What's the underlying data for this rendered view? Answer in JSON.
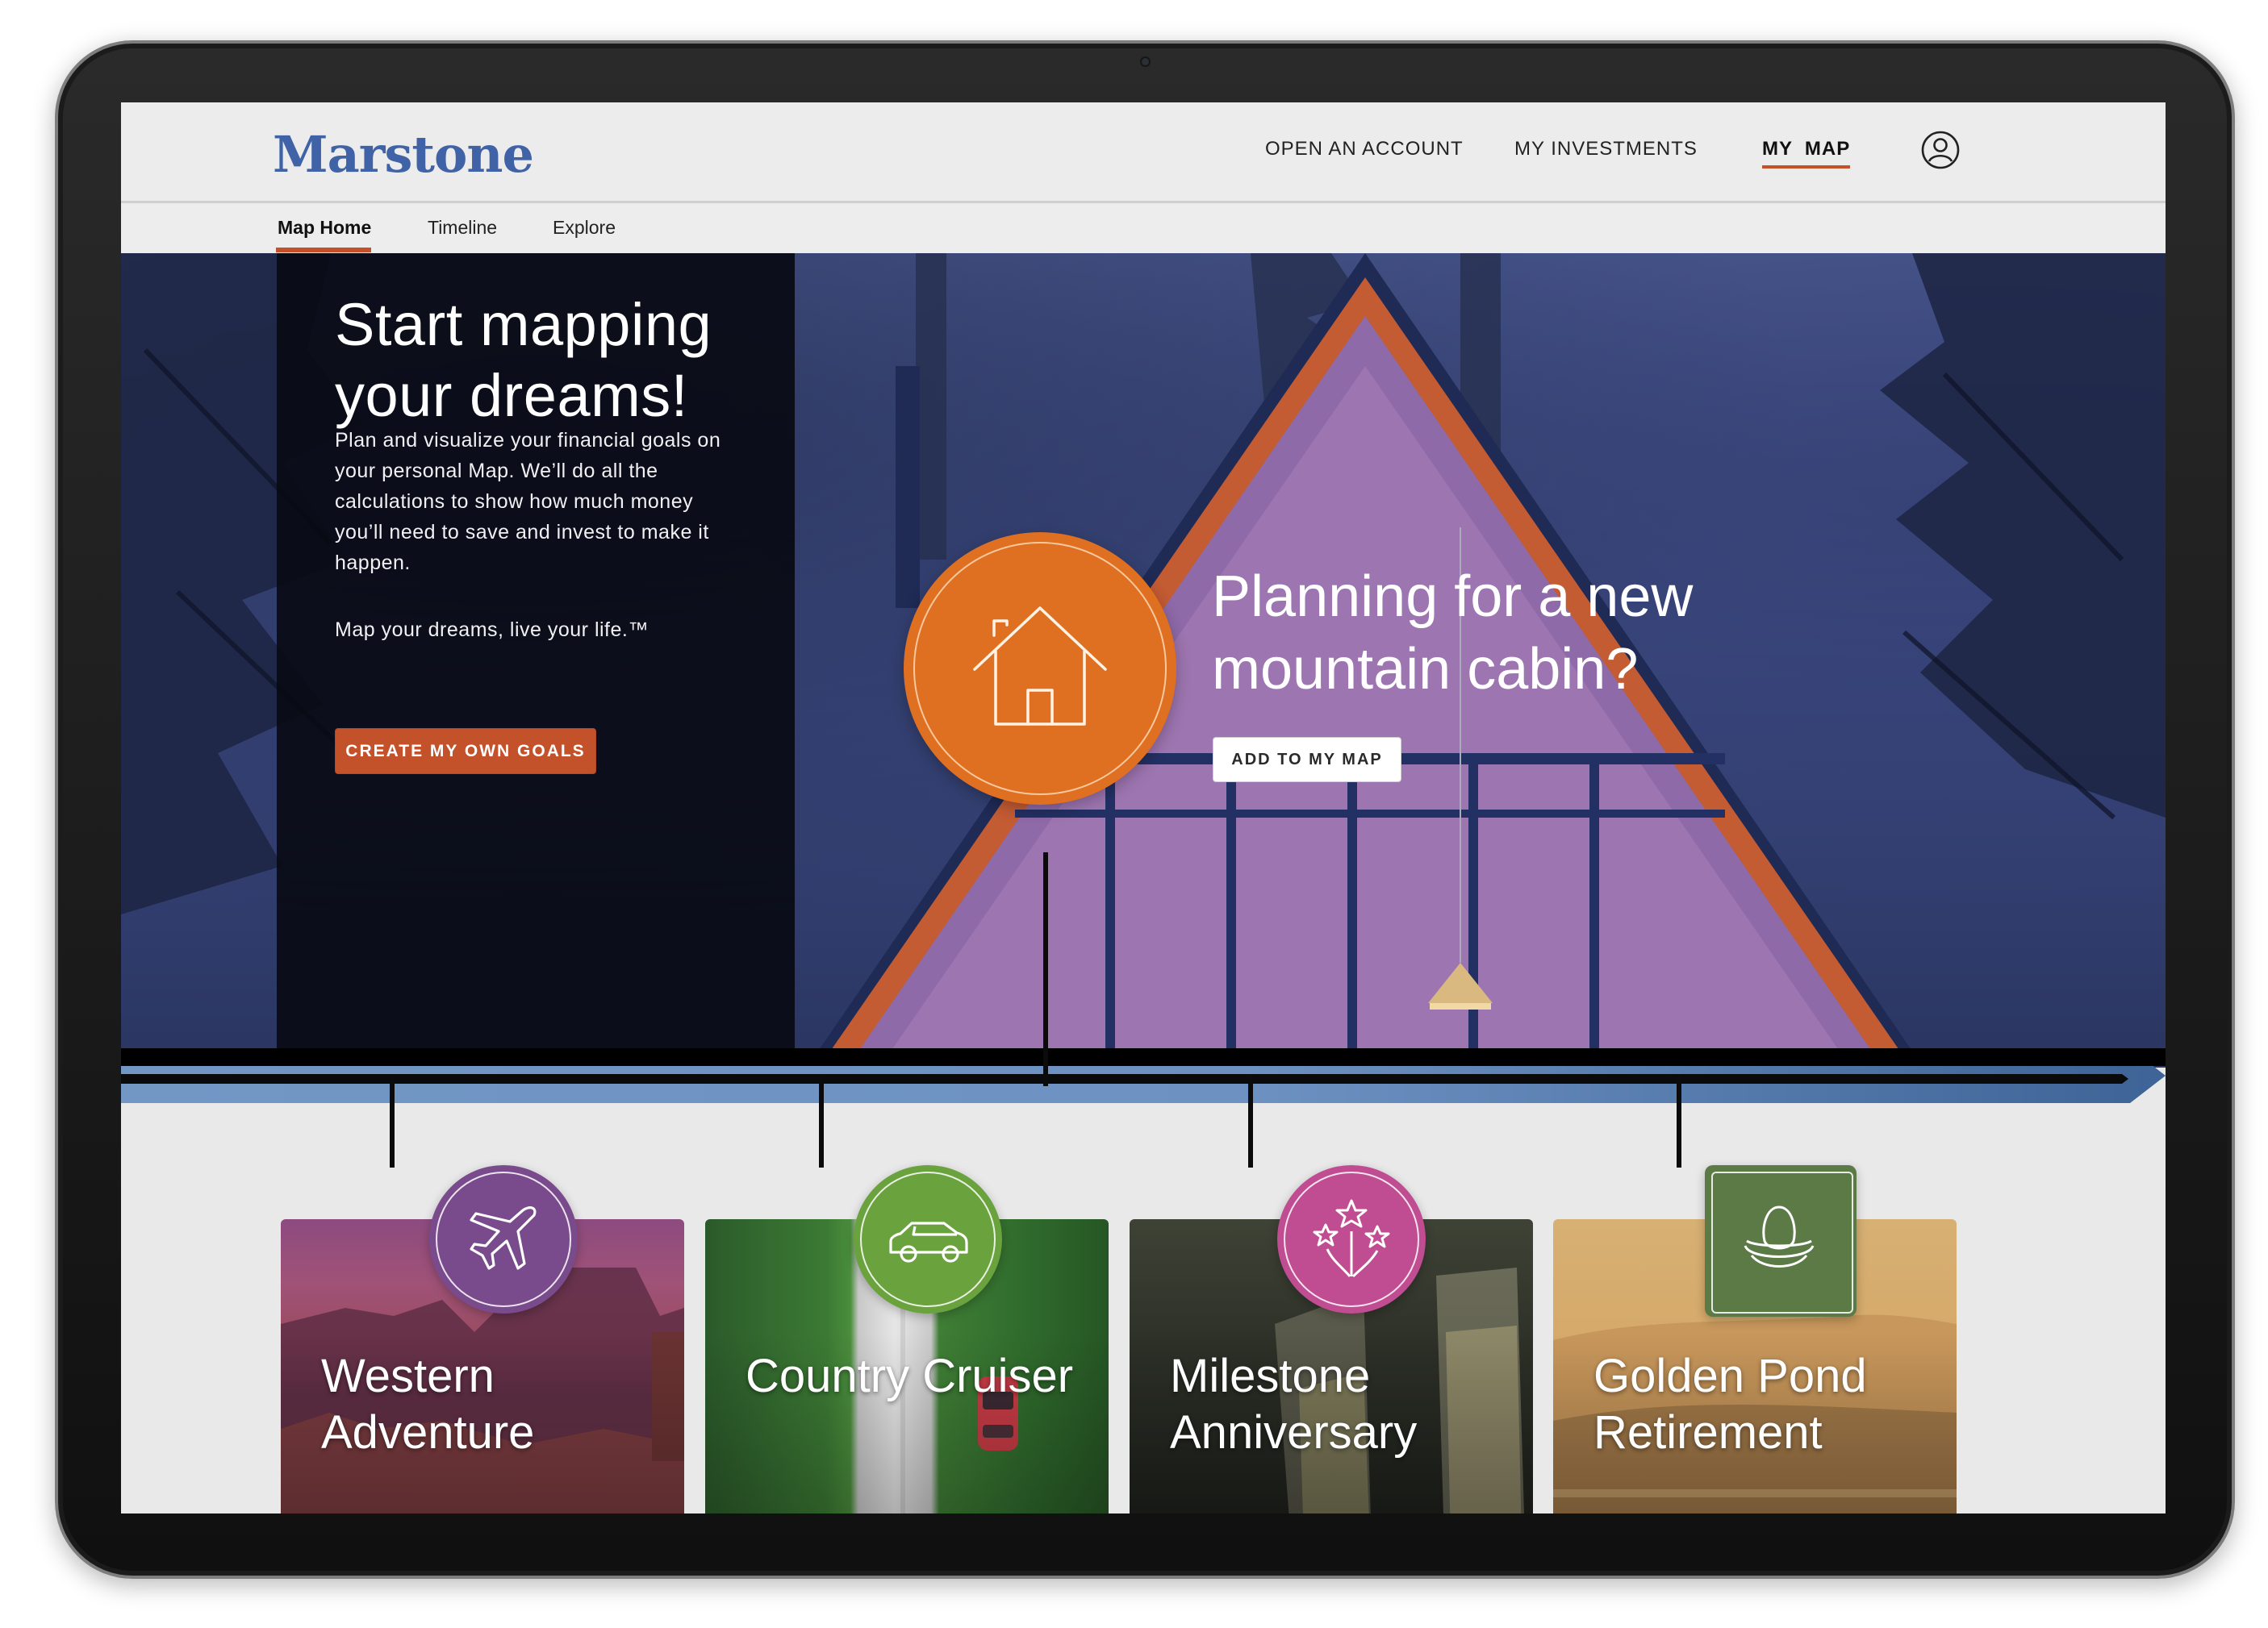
{
  "header": {
    "logo": "Marstone",
    "nav": {
      "open_account": "OPEN AN ACCOUNT",
      "my_investments": "MY INVESTMENTS",
      "my_map": "MY  MAP"
    }
  },
  "subnav": {
    "map_home": "Map Home",
    "timeline": "Timeline",
    "explore": "Explore"
  },
  "hero": {
    "title": "Start mapping your dreams!",
    "body": "Plan and visualize your financial goals on your personal Map. We’ll do all the calculations to show how much money you’ll need to save and invest to make it happen.",
    "tagline": "Map your dreams, live your life.™",
    "cta": "CREATE MY OWN GOALS"
  },
  "featured": {
    "title": "Planning for a new mountain cabin?",
    "cta": "ADD TO MY MAP",
    "icon": "house-icon",
    "color": "#e07021"
  },
  "goals": [
    {
      "title": "Western Adventure",
      "icon": "airplane-icon",
      "color": "#7a4b8c"
    },
    {
      "title": "Country Cruiser",
      "icon": "car-icon",
      "color": "#6aa23e"
    },
    {
      "title": "Milestone Anniversary",
      "icon": "fireworks-icon",
      "color": "#c04c91"
    },
    {
      "title": "Golden Pond Retirement",
      "icon": "nest-egg-icon",
      "color": "#5b7a45"
    }
  ],
  "colors": {
    "brand_blue": "#3f63a6",
    "accent_orange": "#c3512a",
    "timeline_blue": "#6a8fbf"
  }
}
